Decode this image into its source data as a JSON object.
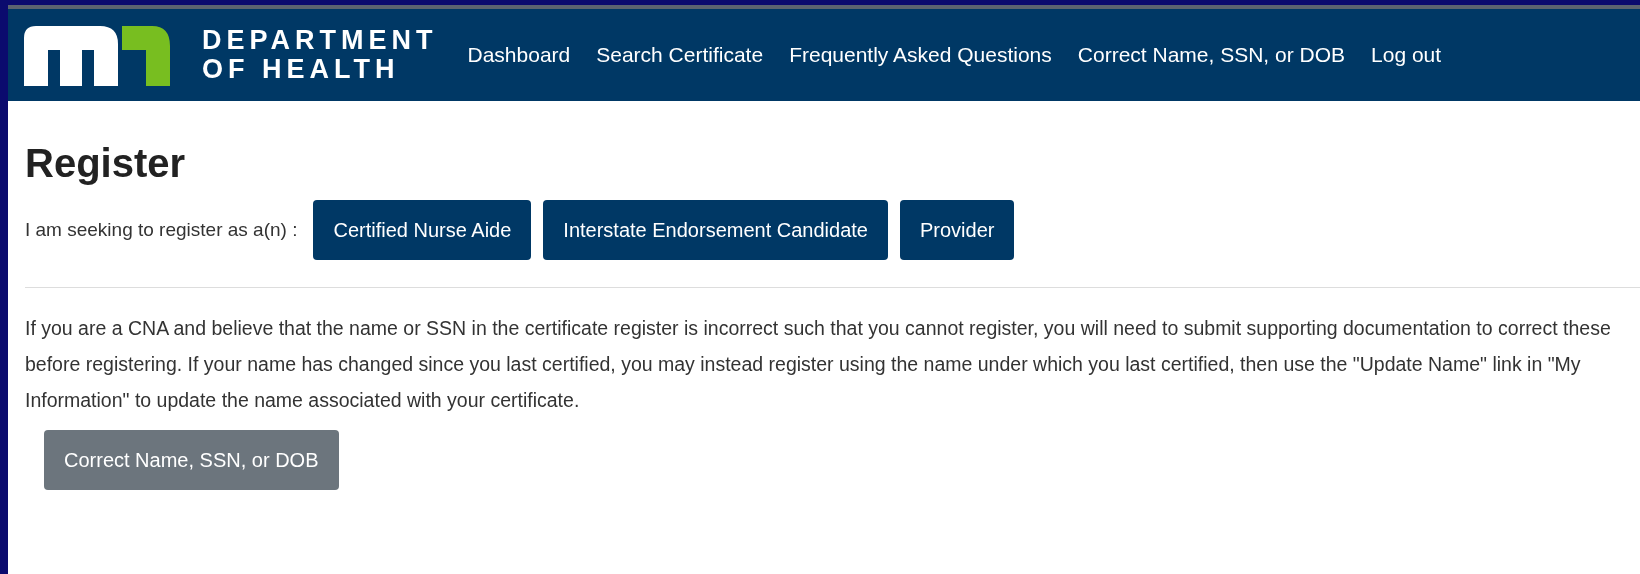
{
  "header": {
    "logo_lines": [
      "DEPARTMENT",
      "OF HEALTH"
    ],
    "nav": [
      "Dashboard",
      "Search Certificate",
      "Frequently Asked Questions",
      "Correct Name, SSN, or DOB",
      "Log out"
    ]
  },
  "page": {
    "title": "Register",
    "role_prompt": "I am seeking to register as a(n) :",
    "role_buttons": [
      "Certified Nurse Aide",
      "Interstate Endorsement Candidate",
      "Provider"
    ],
    "notice": "If you are a CNA and believe that the name or SSN in the certificate register is incorrect such that you cannot register, you will need to submit supporting documentation to correct these before registering. If your name has changed since you last certified, you may instead register using the name under which you last certified, then use the \"Update Name\" link in \"My Information\" to update the name associated with your certificate.",
    "correct_button": "Correct Name, SSN, or DOB"
  }
}
